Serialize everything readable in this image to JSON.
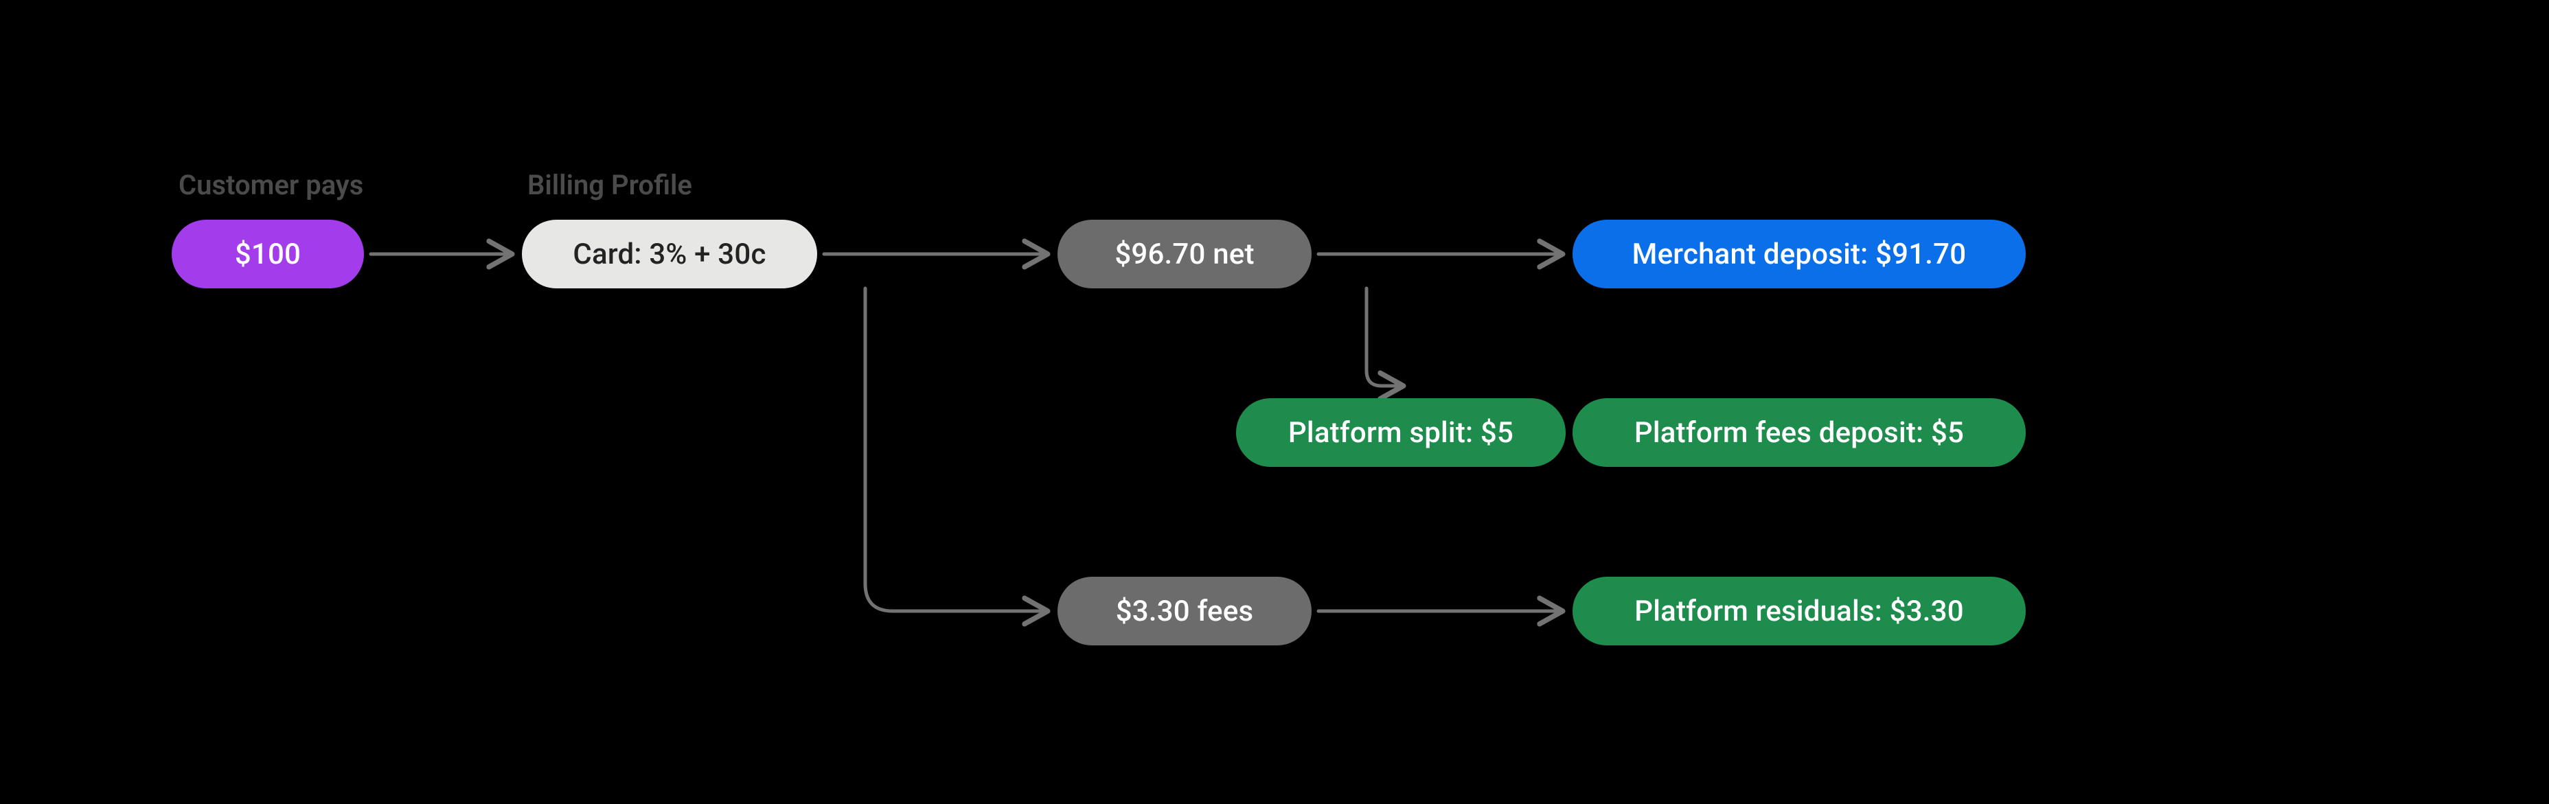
{
  "labels": {
    "customer_pays": "Customer pays",
    "billing_profile": "Billing Profile"
  },
  "nodes": {
    "customer_amount": "$100",
    "billing_rate": "Card: 3% + 30c",
    "net_amount": "$96.70 net",
    "merchant_deposit": "Merchant deposit: $91.70",
    "platform_split": "Platform split: $5",
    "platform_fees_deposit": "Platform fees deposit: $5",
    "fees_amount": "$3.30 fees",
    "platform_residuals": "Platform residuals: $3.30"
  },
  "colors": {
    "purple": "#a33cea",
    "light": "#e7e7e5",
    "gray": "#6c6c6c",
    "blue": "#0a6fe8",
    "green": "#1e8c4c",
    "label": "#4b4b4b",
    "arrow": "#737373"
  }
}
